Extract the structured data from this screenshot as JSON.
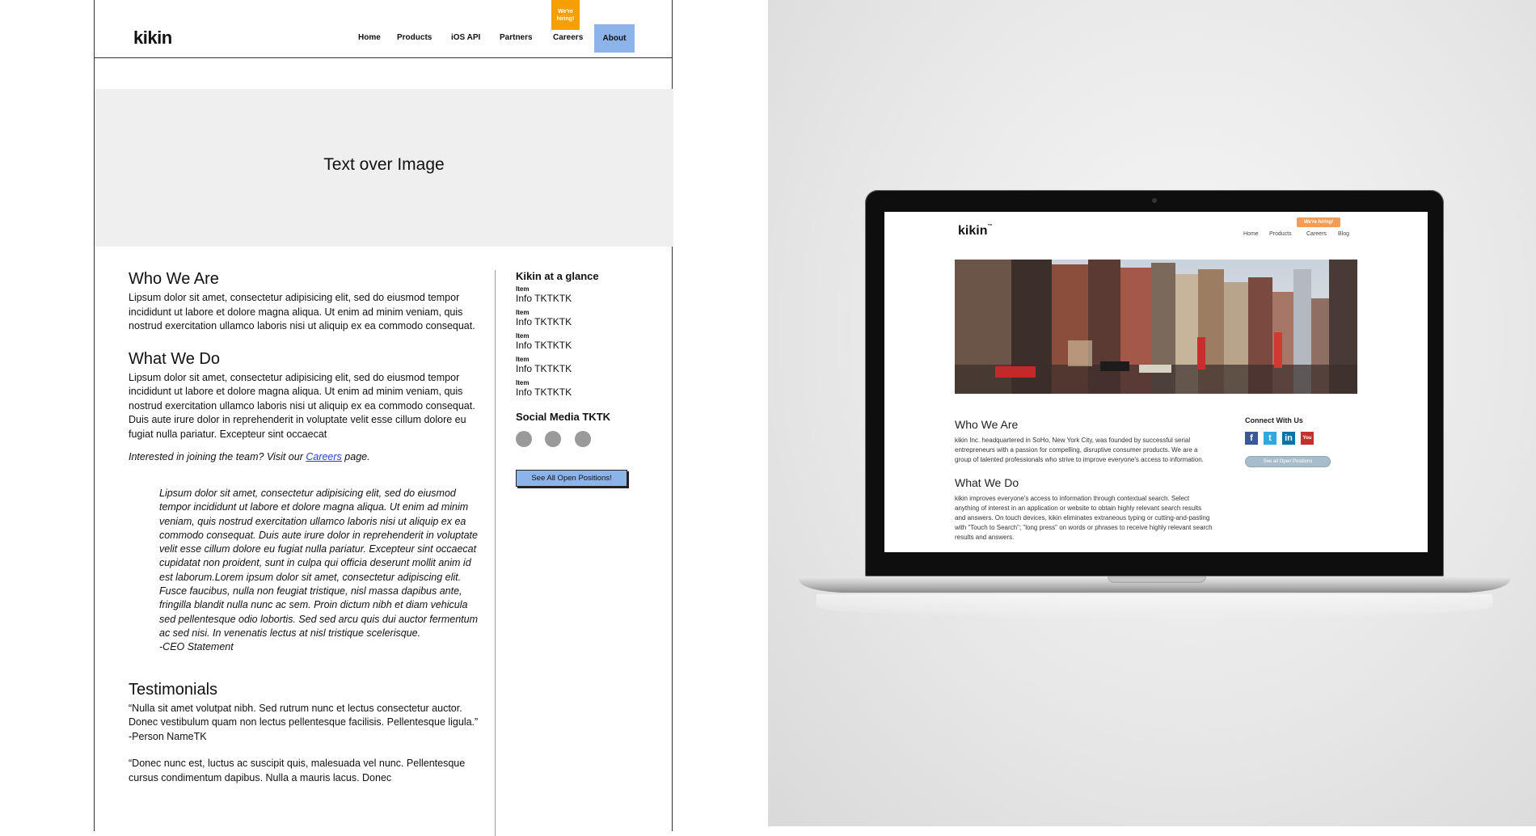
{
  "wireframe": {
    "logo": "kikin",
    "hiring_badge": "We're hiring!",
    "nav": [
      "Home",
      "Products",
      "iOS API",
      "Partners",
      "Careers"
    ],
    "nav_active": "About",
    "hero_text": "Text over Image",
    "who_title": "Who We Are",
    "who_body": "Lipsum dolor sit amet, consectetur adipisicing elit, sed do eiusmod tempor incididunt ut labore et dolore magna aliqua. Ut enim ad minim veniam, quis nostrud exercitation ullamco laboris nisi ut aliquip ex ea commodo consequat.",
    "what_title": "What We Do",
    "what_body": "Lipsum dolor sit amet, consectetur adipisicing elit, sed do eiusmod tempor incididunt ut labore et dolore magna aliqua. Ut enim ad minim veniam, quis nostrud exercitation ullamco laboris nisi ut aliquip ex ea commodo consequat. Duis aute irure dolor in reprehenderit in voluptate velit esse cillum dolore eu fugiat nulla pariatur. Excepteur sint occaecat",
    "interest_prefix": "Interested in joining the team? Visit our ",
    "interest_link": "Careers",
    "interest_suffix": " page.",
    "quote": "Lipsum dolor sit amet, consectetur adipisicing elit, sed do eiusmod tempor incididunt ut labore et dolore magna aliqua. Ut enim ad minim veniam, quis nostrud exercitation ullamco laboris nisi ut aliquip ex ea commodo consequat. Duis aute irure dolor in reprehenderit in voluptate velit esse cillum dolore eu fugiat nulla pariatur. Excepteur sint occaecat cupidatat non proident, sunt in culpa qui officia deserunt mollit anim id est laborum.Lorem ipsum dolor sit amet, consectetur adipiscing elit. Fusce faucibus, nulla non feugiat tristique, nisl massa dapibus ante, fringilla blandit nulla nunc ac sem. Proin dictum nibh et diam vehicula sed pellentesque odio lobortis. Sed sed arcu quis dui auctor fermentum ac sed nisi. In venenatis lectus at nisl tristique scelerisque.",
    "quote_attribution": "-CEO Statement",
    "testimonials_title": "Testimonials",
    "testimonial_1": "“Nulla sit amet volutpat nibh. Sed rutrum nunc et lectus consectetur auctor. Donec vestibulum quam non lectus pellentesque facilisis. Pellentesque ligula.”",
    "testimonial_1_person": "-Person NameTK",
    "testimonial_2": "“Donec nunc est, luctus ac suscipit quis, malesuada vel nunc. Pellentesque cursus condimentum dapibus. Nulla a mauris lacus. Donec",
    "sidebar_title": "Kikin at a glance",
    "glance_items": [
      {
        "label": "Item",
        "value": "Info TKTKTK"
      },
      {
        "label": "Item",
        "value": "Info TKTKTK"
      },
      {
        "label": "Item",
        "value": "Info TKTKTK"
      },
      {
        "label": "Item",
        "value": "Info TKTKTK"
      },
      {
        "label": "Item",
        "value": "Info TKTKTK"
      }
    ],
    "social_title": "Social Media TKTK",
    "open_positions_button": "See All Open Positions!"
  },
  "screen": {
    "logo": "kikin",
    "logo_tm": "™",
    "hiring_badge": "We're hiring!",
    "nav": [
      "Home",
      "Products",
      "Careers",
      "Blog"
    ],
    "who_title": "Who We Are",
    "who_body": "kikin Inc. headquartered in SoHo, New York City, was founded by successful serial entrepreneurs with a passion for compelling, disruptive consumer products. We are a group of talented professionals who strive to improve everyone's access to information.",
    "what_title": "What We Do",
    "what_body": "kikin improves everyone's access to information through contextual search. Select anything of interest in an application or website to obtain highly relevant search results and answers. On touch devices, kikin eliminates extraneous typing or cutting-and-pasting with \"Touch to Search\"; \"long press\" on words or phrases to receive highly relevant search results and answers.",
    "connect_title": "Connect With Us",
    "social_icons": [
      {
        "name": "facebook-icon",
        "glyph": "f",
        "color": "#3b5998"
      },
      {
        "name": "twitter-icon",
        "glyph": "t",
        "color": "#2fa8e0"
      },
      {
        "name": "linkedin-icon",
        "glyph": "in",
        "color": "#0b73a8"
      },
      {
        "name": "youtube-icon",
        "glyph": "You",
        "color": "#c4302b"
      }
    ],
    "open_positions_button": "See all Open Positions"
  },
  "colors": {
    "wire_hiring": "#f5a000",
    "wire_accent": "#8cb4ea",
    "screen_hiring": "#f49b55",
    "screen_button": "#a7bdcb"
  }
}
